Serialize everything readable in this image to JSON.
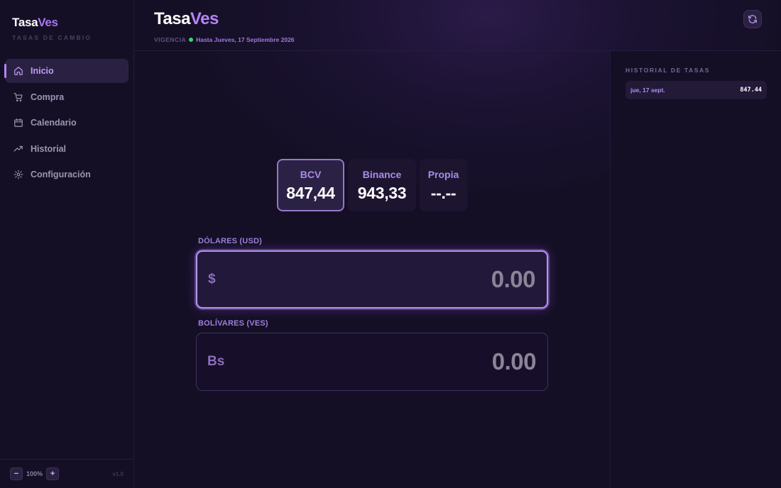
{
  "sidebar": {
    "brand_a": "Tasa",
    "brand_b": "Ves",
    "brand_sub": "TASAS DE CAMBIO",
    "items": [
      {
        "label": "Inicio",
        "icon": "home-icon",
        "active": true
      },
      {
        "label": "Compra",
        "icon": "cart-icon",
        "active": false
      },
      {
        "label": "Calendario",
        "icon": "calendar-icon",
        "active": false
      },
      {
        "label": "Historial",
        "icon": "trending-icon",
        "active": false
      },
      {
        "label": "Configuración",
        "icon": "gear-icon",
        "active": false
      }
    ],
    "footer": {
      "zoom_out": "−",
      "zoom": "100%",
      "zoom_in": "+",
      "version": "v1.0"
    }
  },
  "header": {
    "title_a": "Tasa",
    "title_b": "Ves",
    "vigencia_label": "VIGENCIA",
    "vigencia_value": "Hasta Jueves, 17 Septiembre 2026",
    "refresh_icon": "refresh-icon"
  },
  "rates": [
    {
      "label": "BCV",
      "value": "847,44",
      "active": true
    },
    {
      "label": "Binance",
      "value": "943,33",
      "active": false
    },
    {
      "label": "Propia",
      "value": "--.--",
      "active": false
    }
  ],
  "converter": {
    "usd_label": "DÓLARES (USD)",
    "usd_symbol": "$",
    "usd_value": "0.00",
    "ves_label": "BOLÍVARES (VES)",
    "ves_symbol": "Bs",
    "ves_value": "0.00"
  },
  "history": {
    "title": "HISTORIAL DE TASAS",
    "rows": [
      {
        "date": "jue, 17 sept.",
        "value": "847.44"
      }
    ]
  },
  "colors": {
    "accent": "#b285f5",
    "background": "#140e24",
    "status_ok": "#39d36a"
  }
}
